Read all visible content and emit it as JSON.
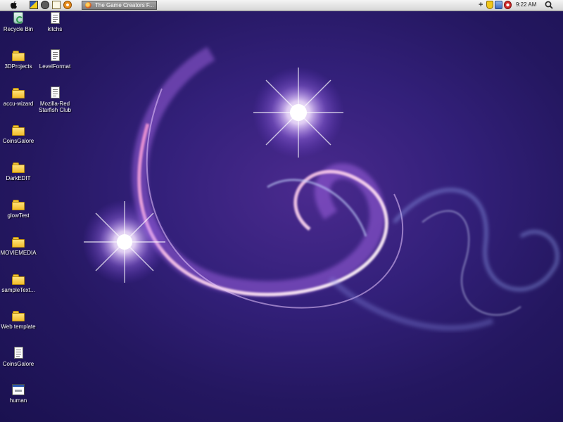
{
  "menubar": {
    "apple_icon": "apple-logo-icon",
    "quick_launch": [
      "show-desktop-icon",
      "cat-app-icon",
      "notepad-icon",
      "blender-icon"
    ],
    "task_button": {
      "label": "The Game Creators F...",
      "icon": "firefox-icon"
    }
  },
  "tray": {
    "plus": "+",
    "icons": [
      "shield-icon",
      "network-icon",
      "alert-icon"
    ],
    "clock": "9:22 AM",
    "search_icon": "search-icon"
  },
  "desktop": {
    "column1": [
      {
        "label": "Recycle Bin",
        "icon": "recycle-bin-icon"
      },
      {
        "label": "3DProjects",
        "icon": "folder-icon"
      },
      {
        "label": "accu-wizard",
        "icon": "folder-icon"
      },
      {
        "label": "CoinsGalore",
        "icon": "folder-icon"
      },
      {
        "label": "DarkEDIT",
        "icon": "folder-icon"
      },
      {
        "label": "glowTest",
        "icon": "folder-icon"
      },
      {
        "label": "MOVIEMEDIA",
        "icon": "folder-icon"
      },
      {
        "label": "sampleText...",
        "icon": "folder-icon"
      },
      {
        "label": "Web template",
        "icon": "folder-icon"
      },
      {
        "label": "CoinsGalore",
        "icon": "text-document-icon"
      },
      {
        "label": "human",
        "icon": "application-icon"
      }
    ],
    "column2": [
      {
        "label": "kitchs",
        "icon": "text-document-icon"
      },
      {
        "label": "LevelFormat",
        "icon": "text-document-icon"
      },
      {
        "label": "Mozilla-Red Starfish Club",
        "icon": "text-document-icon"
      }
    ]
  },
  "colors": {
    "wallpaper_base": "#2a1a6a",
    "wallpaper_glow": "#c8a8ff",
    "menubar": "#e4e4e4",
    "taskbutton": "#8f8f8f"
  }
}
